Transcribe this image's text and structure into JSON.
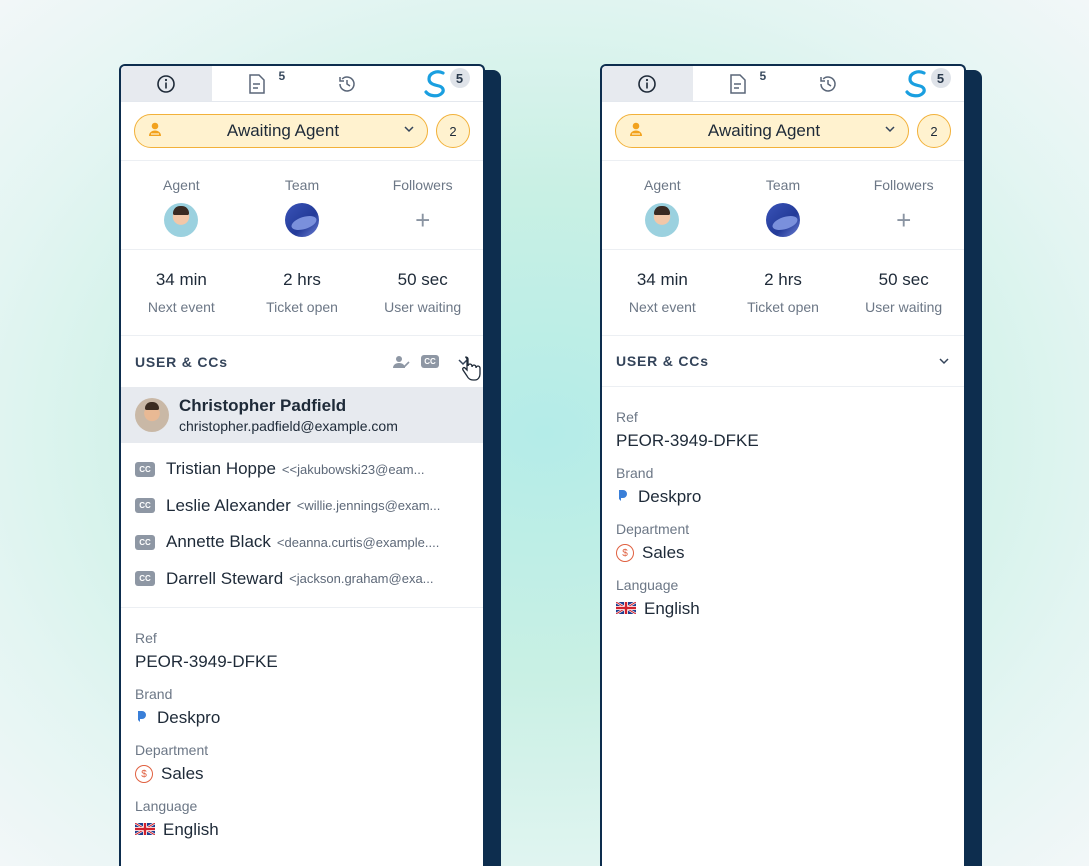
{
  "colors": {
    "accent": "#1a9fe0",
    "status_border": "#f2b13a",
    "status_bg": "#fff2cf",
    "panel_border": "#0d2d4e"
  },
  "tabs": [
    {
      "icon": "info-icon",
      "active": true
    },
    {
      "icon": "document-icon",
      "badge": "5"
    },
    {
      "icon": "history-icon"
    },
    {
      "icon": "deskpro-apps-icon",
      "badge": "5"
    }
  ],
  "status": {
    "label": "Awaiting Agent",
    "count": "2"
  },
  "assign": {
    "agent_label": "Agent",
    "team_label": "Team",
    "followers_label": "Followers",
    "followers_add": "+"
  },
  "times": [
    {
      "value": "34 min",
      "label": "Next event"
    },
    {
      "value": "2 hrs",
      "label": "Ticket open"
    },
    {
      "value": "50 sec",
      "label": "User waiting"
    }
  ],
  "users_section": {
    "title": "USER & CCs",
    "user": {
      "name": "Christopher Padfield",
      "email": "christopher.padfield@example.com"
    },
    "cc_tag": "CC",
    "ccs": [
      {
        "name": "Tristian Hoppe",
        "email": "<<jakubowski23@eam..."
      },
      {
        "name": "Leslie Alexander",
        "email": "<willie.jennings@exam..."
      },
      {
        "name": "Annette Black",
        "email": "<deanna.curtis@example...."
      },
      {
        "name": "Darrell Steward",
        "email": "<jackson.graham@exa..."
      }
    ]
  },
  "fields": {
    "ref_label": "Ref",
    "ref_value": "PEOR-3949-DFKE",
    "brand_label": "Brand",
    "brand_value": "Deskpro",
    "department_label": "Department",
    "department_value": "Sales",
    "language_label": "Language",
    "language_value": "English"
  }
}
